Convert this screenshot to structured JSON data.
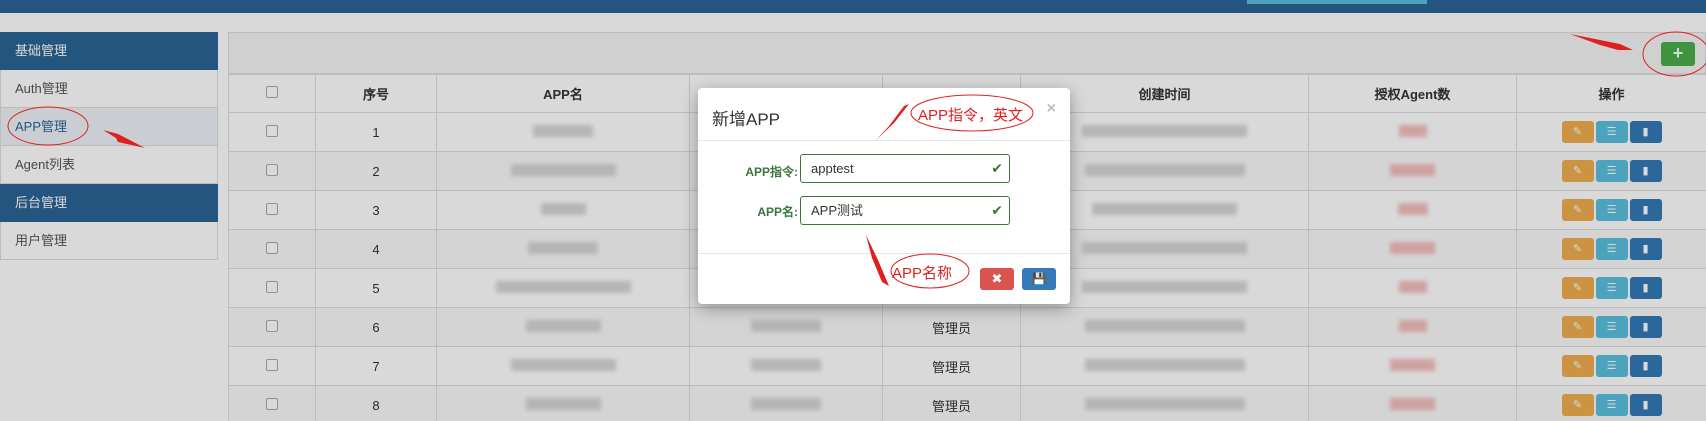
{
  "sidebar": {
    "items": [
      {
        "label": "基础管理",
        "type": "header"
      },
      {
        "label": "Auth管理",
        "type": "item"
      },
      {
        "label": "APP管理",
        "type": "active"
      },
      {
        "label": "Agent列表",
        "type": "item"
      },
      {
        "label": "后台管理",
        "type": "header"
      },
      {
        "label": "用户管理",
        "type": "item"
      }
    ]
  },
  "toolbar": {
    "add_label": "+"
  },
  "table": {
    "headers": {
      "index": "序号",
      "app_name": "APP名",
      "created": "创建时间",
      "agent_count": "授权Agent数",
      "ops": "操作"
    },
    "rows": [
      {
        "index": "1",
        "role": ""
      },
      {
        "index": "2",
        "role": ""
      },
      {
        "index": "3",
        "role": ""
      },
      {
        "index": "4",
        "role": ""
      },
      {
        "index": "5",
        "role": ""
      },
      {
        "index": "6",
        "role": "管理员"
      },
      {
        "index": "7",
        "role": "管理员"
      },
      {
        "index": "8",
        "role": "管理员"
      }
    ]
  },
  "modal": {
    "title": "新增APP",
    "close": "×",
    "fields": {
      "command_label": "APP指令:",
      "command_value": "apptest",
      "name_label": "APP名:",
      "name_value": "APP测试"
    },
    "cancel_label": "✖",
    "save_label": "💾"
  },
  "annotations": {
    "command_note": "APP指令，英文",
    "name_note": "APP名称"
  },
  "colors": {
    "primary": "#2a6496",
    "success": "#3c763d",
    "danger": "#d9534f",
    "warning": "#f0ad4e",
    "info": "#5bc0de",
    "annotation": "#e02020"
  }
}
